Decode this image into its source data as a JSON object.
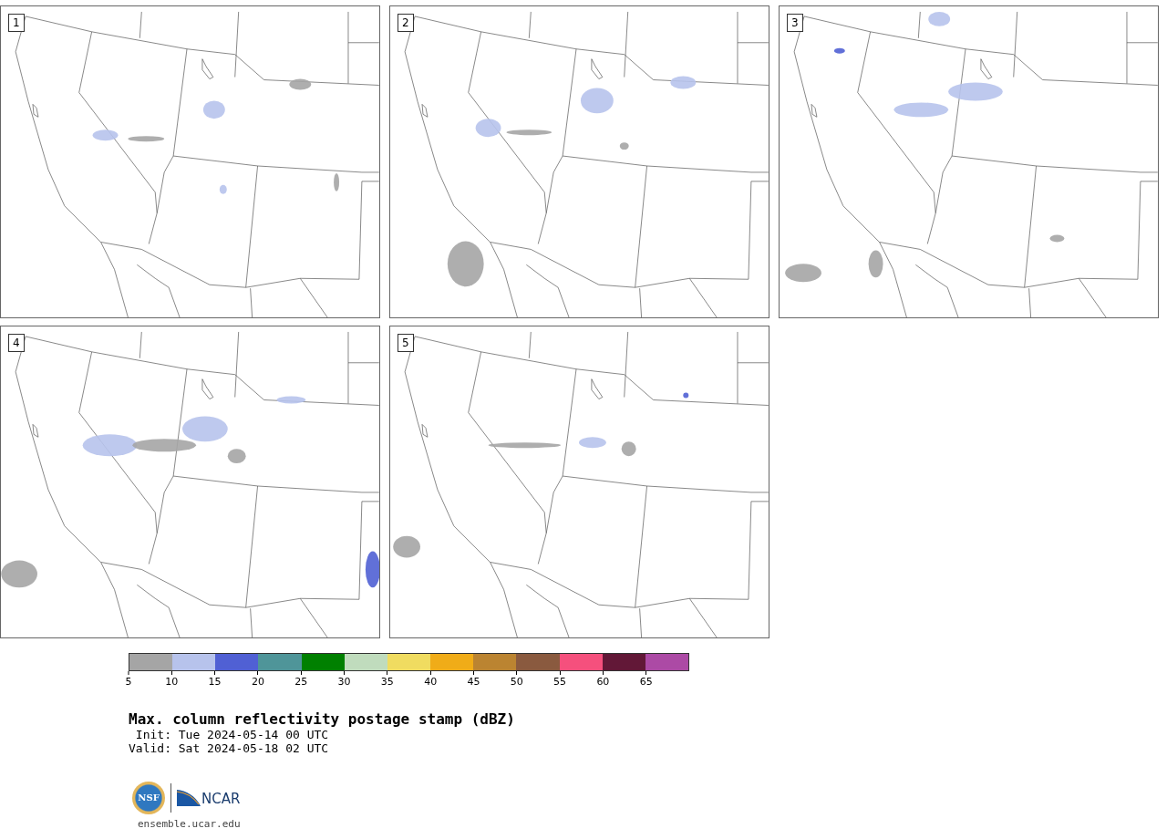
{
  "panels": [
    {
      "number": "1"
    },
    {
      "number": "2"
    },
    {
      "number": "3"
    },
    {
      "number": "4"
    },
    {
      "number": "5"
    }
  ],
  "colorbar": {
    "bins": [
      {
        "color": "#a5a5a5"
      },
      {
        "color": "#b7c3ec"
      },
      {
        "color": "#5060d4"
      },
      {
        "color": "#4f9599"
      },
      {
        "color": "#008000"
      },
      {
        "color": "#c0dcbd"
      },
      {
        "color": "#f0dc60"
      },
      {
        "color": "#f0ac18"
      },
      {
        "color": "#bb8431"
      },
      {
        "color": "#8a5a3f"
      },
      {
        "color": "#f5507d"
      },
      {
        "color": "#621837"
      },
      {
        "color": "#ac4aa5"
      }
    ],
    "ticks": [
      "5",
      "10",
      "15",
      "20",
      "25",
      "30",
      "35",
      "40",
      "45",
      "50",
      "55",
      "60",
      "65"
    ]
  },
  "title": "Max. column reflectivity postage stamp (dBZ)",
  "init": " Init: Tue 2024-05-14 00 UTC",
  "valid": "Valid: Sat 2024-05-18 02 UTC",
  "logo": {
    "emblem_text": "NSF",
    "wordmark": "NCAR"
  },
  "footer_url": "ensemble.ucar.edu"
}
